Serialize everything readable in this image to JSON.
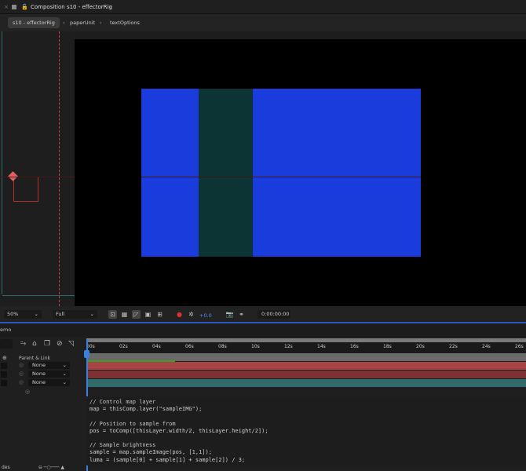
{
  "window": {
    "title": "Composition s10 - effectorRig",
    "menu_icon": "≡"
  },
  "breadcrumbs": [
    {
      "label": "s10 - effectorRig"
    },
    {
      "label": "paperUnit"
    },
    {
      "label": "textOptions"
    }
  ],
  "toolbar": {
    "zoom": "50%",
    "resolution": "Full",
    "exposure": "+0.0",
    "timecode": "0:00:00:00"
  },
  "panel": {
    "title": "emo"
  },
  "timeline": {
    "column_header": "Parent & Link",
    "ticks": [
      "00s",
      "02s",
      "04s",
      "06s",
      "08s",
      "10s",
      "12s",
      "14s",
      "16s",
      "18s",
      "20s",
      "22s",
      "24s",
      "26s"
    ],
    "layers": [
      {
        "parent": "None",
        "color": "#a84444"
      },
      {
        "parent": "None",
        "color": "#7a3232"
      },
      {
        "parent": "None",
        "color": "#2f6b6b"
      }
    ]
  },
  "code": [
    "// Control map layer",
    "map = thisComp.layer(\"sampleIMG\");",
    "",
    "// Position to sample from",
    "pos = toComp([thisLayer.width/2, thisLayer.height/2]);",
    "",
    "// Sample brightness",
    "sample = map.sampleImage(pos, [1,1]);",
    "luma = (sample[0] + sample[1] + sample[2]) / 3;"
  ],
  "colors": {
    "accent": "#2a58c0",
    "comp_blue": "#1a3cdc",
    "comp_teal": "#0c3434"
  }
}
